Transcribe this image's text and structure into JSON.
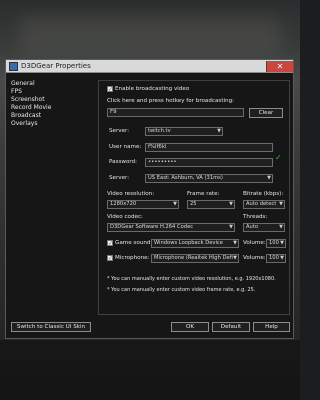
{
  "window": {
    "title": "D3DGear Properties",
    "close": "✕"
  },
  "sidebar": {
    "items": [
      "General",
      "FPS",
      "Screenshot",
      "Record Movie",
      "Broadcast",
      "Overlays"
    ]
  },
  "broadcast": {
    "enable_label": "Enable broadcasting video",
    "hotkey_label": "Click here and press hotkey for broadcasting:",
    "hotkey_value": "F9",
    "clear_label": "Clear",
    "server_label": "Server:",
    "server_value": "twitch.tv",
    "username_label": "User name:",
    "username_value": "f%lf6kl",
    "password_label": "Password:",
    "password_value": "•••••••••",
    "server2_label": "Server:",
    "server2_value": "US East: Ashburn, VA   (31ms)",
    "resolution_label": "Video resolution:",
    "resolution_value": "1280x720",
    "framerate_label": "Frame rate:",
    "framerate_value": "25",
    "bitrate_label": "Bitrate (kbps):",
    "bitrate_value": "Auto detect",
    "codec_label": "Video codec:",
    "codec_value": "D3DGear Software H.264 Codec",
    "threads_label": "Threads:",
    "threads_value": "Auto",
    "game_sound_label": "Game sound:",
    "game_sound_value": "Windows Loopback Device",
    "game_volume_label": "Volume:",
    "game_volume_value": "100",
    "mic_label": "Microphone:",
    "mic_value": "Microphone (Realtek High Defi",
    "mic_volume_label": "Volume:",
    "mic_volume_value": "100",
    "note1": "* You can manually enter custom video resolution, e.g. 1920x1080.",
    "note2": "* You can manually enter custom video frame rate, e.g. 25."
  },
  "footer": {
    "classic_skin": "Switch to Classic UI Skin",
    "ok": "OK",
    "default": "Default",
    "help": "Help"
  }
}
